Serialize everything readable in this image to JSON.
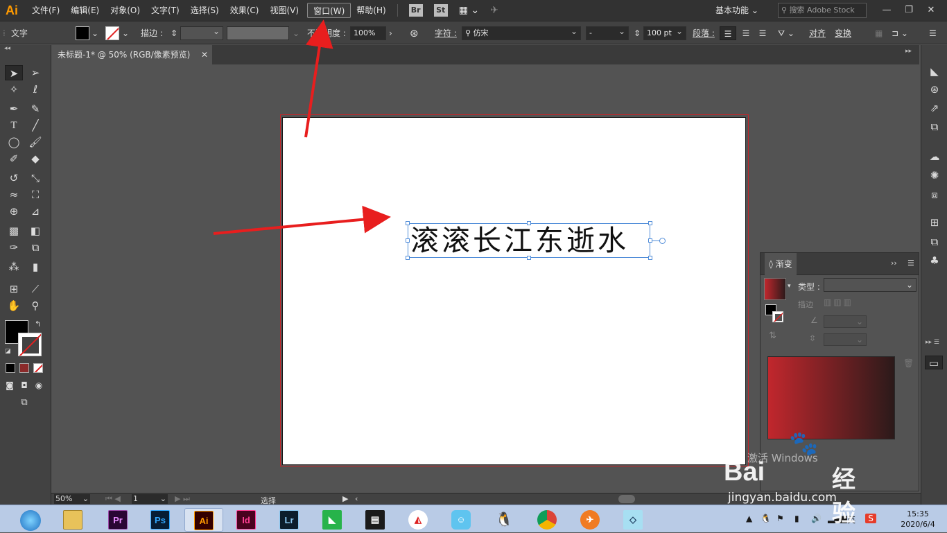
{
  "app": {
    "logo": "Ai",
    "accent": "#ff9a00"
  },
  "menu": {
    "items": [
      "文件(F)",
      "编辑(E)",
      "对象(O)",
      "文字(T)",
      "选择(S)",
      "效果(C)",
      "视图(V)",
      "窗口(W)",
      "帮助(H)"
    ],
    "active": "窗口(W)",
    "bridge": "Br",
    "stock": "St",
    "workspace": "基本功能",
    "search_placeholder": "搜索 Adobe Stock"
  },
  "controlbar": {
    "tool_label": "文字",
    "stroke_label": "描边 :",
    "opacity_label": "不透明度 :",
    "opacity_value": "100%",
    "char_label": "字符 :",
    "font_name": "仿宋",
    "font_style": "-",
    "font_size": "100 pt",
    "para_label": "段落 :",
    "align_label": "对齐",
    "transform_label": "变换"
  },
  "document": {
    "tab_title": "未标题-1* @ 50% (RGB/像素预览)",
    "text_content": "滚滚长江东逝水"
  },
  "gradient_panel": {
    "title": "渐变",
    "type_label": "类型 :",
    "stroke_label": "描边",
    "gradient_start": "#c1272d",
    "gradient_end": "#2b1a1a"
  },
  "statusbar": {
    "zoom": "50%",
    "page": "1",
    "mode": "选择"
  },
  "taskbar": {
    "apps": [
      "Pr",
      "Ps",
      "Ai",
      "Id",
      "Lr"
    ],
    "lang": "英",
    "time": "15:35",
    "date": "2020/6/4"
  },
  "watermark": {
    "brand": "Bai",
    "brand_cn": "经验",
    "url": "jingyan.baidu.com",
    "activate": "激活 Windows"
  }
}
